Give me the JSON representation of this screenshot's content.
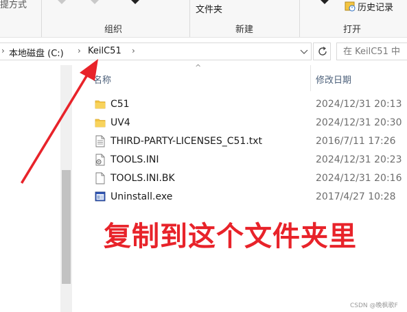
{
  "ribbon": {
    "cut_text": "提方式",
    "folder_label": "文件夹",
    "history_label": "历史记录",
    "groups": {
      "organize": "组织",
      "new": "新建",
      "open": "打开"
    }
  },
  "address": {
    "crumbs": [
      "本地磁盘 (C:)",
      "KeilC51"
    ],
    "search_placeholder": "在 KeilC51 中"
  },
  "columns": {
    "name": "名称",
    "date": "修改日期"
  },
  "files": [
    {
      "name": "C51",
      "date": "2024/12/31 20:13",
      "icon": "folder-icon"
    },
    {
      "name": "UV4",
      "date": "2024/12/31 20:30",
      "icon": "folder-icon"
    },
    {
      "name": "THIRD-PARTY-LICENSES_C51.txt",
      "date": "2016/7/11 17:26",
      "icon": "text-file-icon"
    },
    {
      "name": "TOOLS.INI",
      "date": "2024/12/31 20:23",
      "icon": "ini-file-icon"
    },
    {
      "name": "TOOLS.INI.BK",
      "date": "2024/12/31 20:16",
      "icon": "blank-file-icon"
    },
    {
      "name": "Uninstall.exe",
      "date": "2017/4/27 10:28",
      "icon": "exe-icon"
    }
  ],
  "annotation": "复制到这个文件夹里",
  "watermark": "CSDN @晚枫歌F",
  "colors": {
    "accent_red": "#e8232a",
    "folder_yellow": "#f4c542"
  }
}
